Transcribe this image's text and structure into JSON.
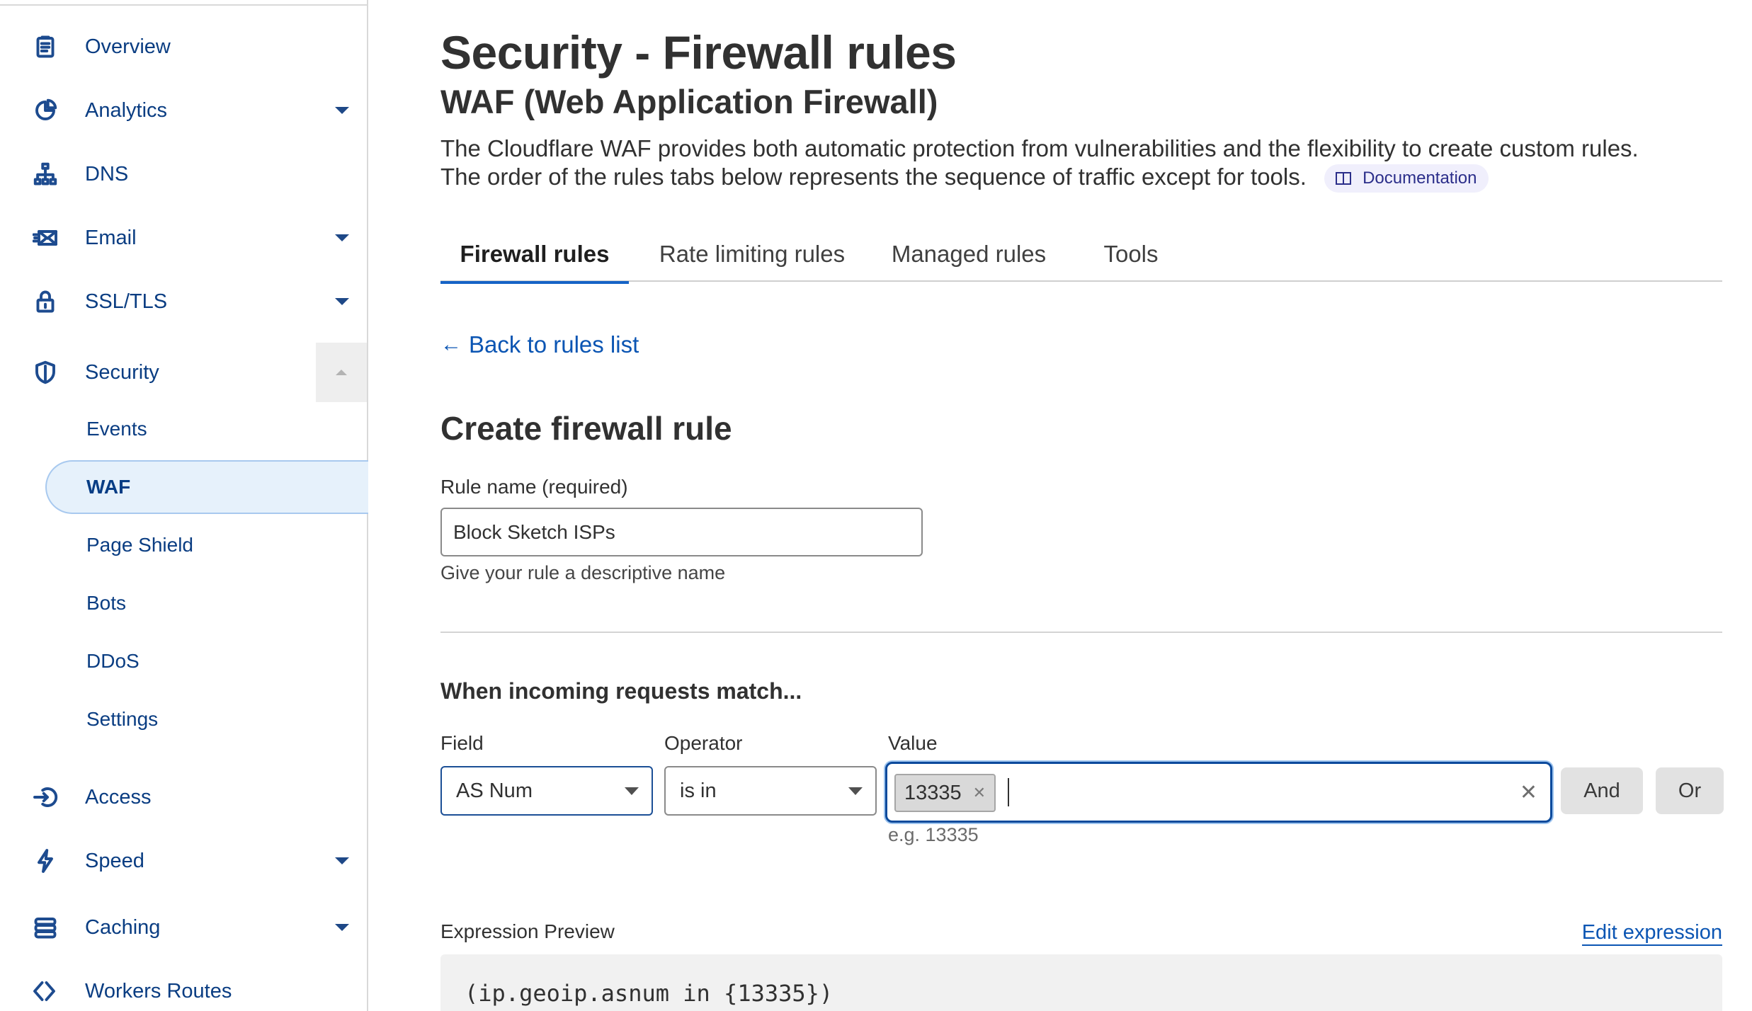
{
  "sidebar": {
    "items": [
      {
        "label": "Overview",
        "icon": "clipboard-icon"
      },
      {
        "label": "Analytics",
        "icon": "pie-chart-icon"
      },
      {
        "label": "DNS",
        "icon": "network-icon"
      },
      {
        "label": "Email",
        "icon": "envelope-icon"
      },
      {
        "label": "SSL/TLS",
        "icon": "lock-icon"
      },
      {
        "label": "Security",
        "icon": "shield-icon"
      },
      {
        "label": "Access",
        "icon": "sign-in-icon"
      },
      {
        "label": "Speed",
        "icon": "lightning-icon"
      },
      {
        "label": "Caching",
        "icon": "server-stack-icon"
      },
      {
        "label": "Workers Routes",
        "icon": "code-brackets-icon"
      }
    ],
    "security_sub_items": [
      "Events",
      "WAF",
      "Page Shield",
      "Bots",
      "DDoS",
      "Settings"
    ],
    "active_sub_item": "WAF"
  },
  "header": {
    "title": "Security - Firewall rules",
    "subtitle": "WAF (Web Application Firewall)",
    "description_line1": "The Cloudflare WAF provides both automatic protection from vulnerabilities and the flexibility to create custom rules.",
    "description_line2": "The order of the rules tabs below represents the sequence of traffic except for tools.",
    "doc_link": "Documentation"
  },
  "tabs": [
    "Firewall rules",
    "Rate limiting rules",
    "Managed rules",
    "Tools"
  ],
  "active_tab": "Firewall rules",
  "back_link": "Back to rules list",
  "form": {
    "section_title": "Create firewall rule",
    "rule_name_label": "Rule name (required)",
    "rule_name_value": "Block Sketch ISPs",
    "rule_name_help": "Give your rule a descriptive name",
    "match_title": "When incoming requests match...",
    "field_label": "Field",
    "field_value": "AS Num",
    "operator_label": "Operator",
    "operator_value": "is in",
    "value_label": "Value",
    "value_tags": [
      "13335"
    ],
    "value_example": "e.g. 13335",
    "and_button": "And",
    "or_button": "Or"
  },
  "expression": {
    "label": "Expression Preview",
    "edit_link": "Edit expression",
    "code": "(ip.geoip.asnum in {13335})"
  },
  "colors": {
    "nav_text": "#0a3d82",
    "link": "#0b55b3",
    "tab_underline": "#1563c6",
    "focus_border": "#0c4a9c",
    "active_nav_bg": "#e6f1fb"
  }
}
